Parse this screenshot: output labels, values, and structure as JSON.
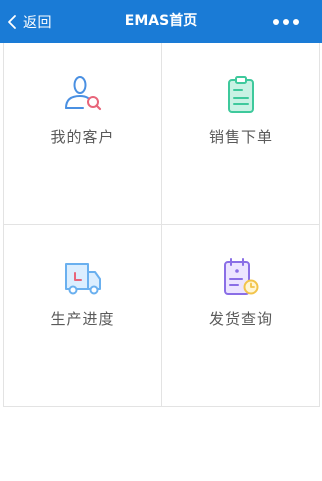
{
  "navbar": {
    "back_label": "返回",
    "title": "EMAS首页",
    "background": "#1a7bd6"
  },
  "menu": [
    {
      "label": "我的客户",
      "icon": "customer-search-icon"
    },
    {
      "label": "销售下单",
      "icon": "clipboard-order-icon"
    },
    {
      "label": "生产进度",
      "icon": "delivery-truck-icon"
    },
    {
      "label": "发货查询",
      "icon": "schedule-clock-icon"
    }
  ]
}
